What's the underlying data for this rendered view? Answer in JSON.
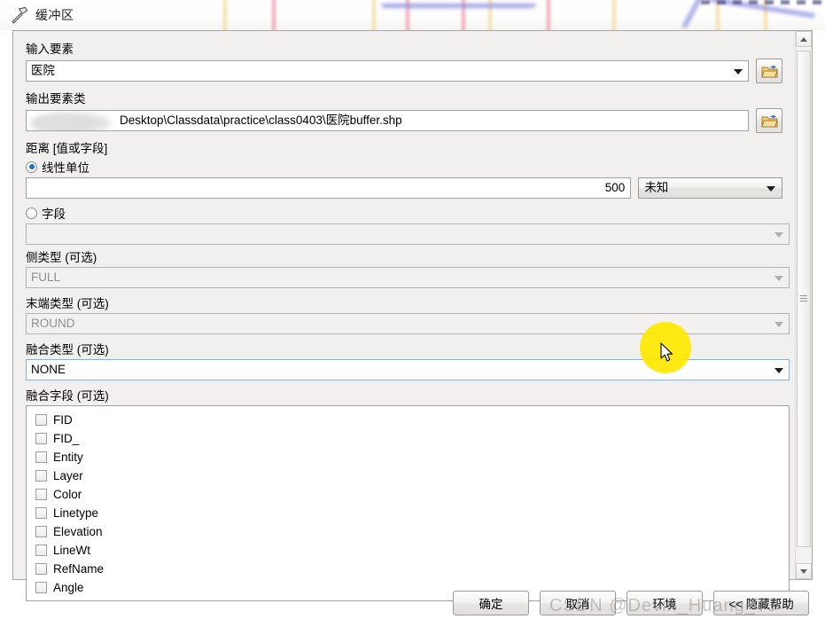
{
  "window": {
    "title": "缓冲区",
    "icon": "hammer-tool-icon"
  },
  "form": {
    "input_features": {
      "label": "输入要素",
      "value": "医院",
      "browse_icon": "open-folder-icon",
      "dropdown_icon": "chevron-down-icon"
    },
    "output_feature_class": {
      "label": "输出要素类",
      "value": "Desktop\\Classdata\\practice\\class0403\\医院buffer.shp",
      "redacted_prefix": true,
      "browse_icon": "open-folder-icon"
    },
    "distance": {
      "label": "距离 [值或字段]",
      "linear_unit": {
        "label": "线性单位",
        "selected": true,
        "value": "500",
        "unit": "未知",
        "unit_dropdown_icon": "chevron-down-icon"
      },
      "field": {
        "label": "字段",
        "selected": false,
        "value": "",
        "disabled": true,
        "dropdown_icon": "chevron-down-icon"
      }
    },
    "side_type": {
      "label": "侧类型 (可选)",
      "value": "FULL",
      "disabled": true,
      "dropdown_icon": "chevron-down-icon"
    },
    "end_type": {
      "label": "末端类型 (可选)",
      "value": "ROUND",
      "disabled": true,
      "dropdown_icon": "chevron-down-icon"
    },
    "dissolve_type": {
      "label": "融合类型 (可选)",
      "value": "NONE",
      "focused": true,
      "dropdown_icon": "chevron-down-icon"
    },
    "dissolve_fields": {
      "label": "融合字段 (可选)",
      "items": [
        {
          "name": "FID",
          "checked": false
        },
        {
          "name": "FID_",
          "checked": false
        },
        {
          "name": "Entity",
          "checked": false
        },
        {
          "name": "Layer",
          "checked": false
        },
        {
          "name": "Color",
          "checked": false
        },
        {
          "name": "Linetype",
          "checked": false
        },
        {
          "name": "Elevation",
          "checked": false
        },
        {
          "name": "LineWt",
          "checked": false
        },
        {
          "name": "RefName",
          "checked": false
        },
        {
          "name": "Angle",
          "checked": false
        }
      ]
    }
  },
  "buttons": {
    "ok": "确定",
    "cancel": "取消",
    "environments": "环境",
    "hide_help": "<< 隐藏帮助"
  },
  "scrollbar": {
    "up_icon": "scroll-up-arrow-icon",
    "down_icon": "scroll-down-arrow-icon"
  },
  "overlay": {
    "watermark": "CSDN @Devin_Huang_TJ",
    "cursor_icon": "mouse-pointer-icon",
    "click_highlight_color": "#ffe800"
  },
  "colors": {
    "dialog_background": "#f0efed",
    "panel_background": "#f1f0ee",
    "field_background": "#ffffff",
    "disabled_field_background": "#f2f1f0",
    "focus_border": "#7eb4e8",
    "radio_selected": "#1f6fc4",
    "folder_icon": "#e8b53c"
  }
}
